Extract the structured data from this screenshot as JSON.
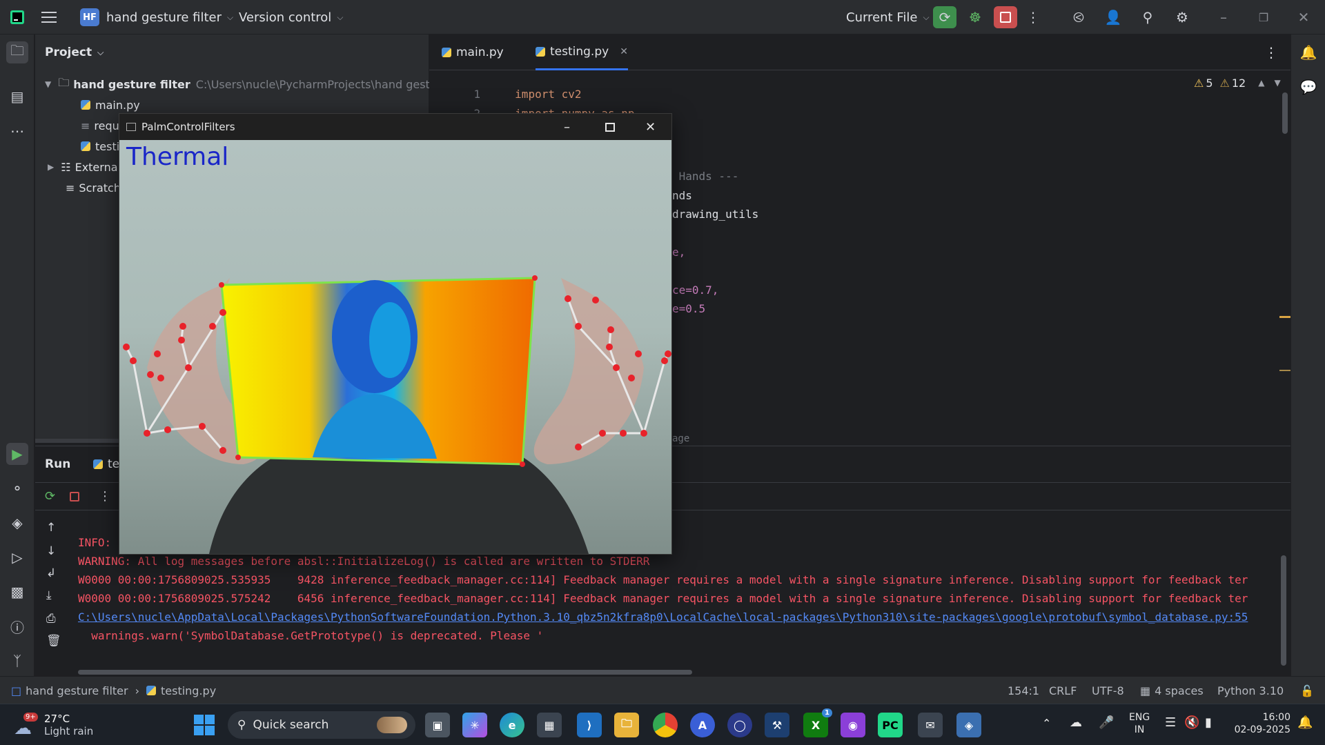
{
  "titlebar": {
    "project_badge": "HF",
    "project_name": "hand gesture filter",
    "vcs_label": "Version control",
    "run_config": "Current File"
  },
  "project_panel": {
    "title": "Project",
    "root_name": "hand gesture filter",
    "root_path": "C:\\Users\\nucle\\PycharmProjects\\hand gestu",
    "items": [
      "main.py",
      "requ",
      "testi",
      "Externa",
      "Scratch"
    ]
  },
  "editor": {
    "tabs": [
      "main.py",
      "testing.py"
    ],
    "inspections": {
      "warnings": "5",
      "weak_warnings": "12"
    },
    "lines": [
      {
        "n": "1",
        "code": "import cv2"
      },
      {
        "n": "2",
        "code": "import numpy as np"
      }
    ],
    "partial_lines": [
      " Hands ---",
      "nds",
      "drawing_utils",
      "e,",
      "ce=0.7,",
      "e=0.5",
      "age"
    ]
  },
  "float_window": {
    "title": "PalmControlFilters",
    "overlay_text": "Thermal"
  },
  "run_panel": {
    "title": "Run",
    "tab_label": "te",
    "logs": [
      {
        "text": "INFO:",
        "type": "err"
      },
      {
        "text": "WARNING: All log messages before absl::InitializeLog() is called are written to STDERR",
        "type": "err"
      },
      {
        "text": "W0000 00:00:1756809025.535935    9428 inference_feedback_manager.cc:114] Feedback manager requires a model with a single signature inference. Disabling support for feedback ter",
        "type": "err"
      },
      {
        "text": "W0000 00:00:1756809025.575242    6456 inference_feedback_manager.cc:114] Feedback manager requires a model with a single signature inference. Disabling support for feedback ter",
        "type": "err"
      },
      {
        "text": "C:\\Users\\nucle\\AppData\\Local\\Packages\\PythonSoftwareFoundation.Python.3.10_qbz5n2kfra8p0\\LocalCache\\local-packages\\Python310\\site-packages\\google\\protobuf\\symbol_database.py:55",
        "type": "link"
      },
      {
        "text": "  warnings.warn('SymbolDatabase.GetPrototype() is deprecated. Please '",
        "type": "err"
      }
    ]
  },
  "statusbar": {
    "breadcrumb_project": "hand gesture filter",
    "breadcrumb_file": "testing.py",
    "position": "154:1",
    "line_sep": "CRLF",
    "encoding": "UTF-8",
    "indent": "4 spaces",
    "interpreter": "Python 3.10"
  },
  "taskbar": {
    "weather_temp": "27°C",
    "weather_desc": "Light rain",
    "weather_badge": "9+",
    "search_placeholder": "Quick search",
    "lang_top": "ENG",
    "lang_bottom": "IN",
    "time": "16:00",
    "date": "02-09-2025",
    "xbox_badge": "1"
  },
  "colors": {
    "ide_bg": "#1e1f22",
    "panel_bg": "#2b2d30",
    "run_green": "#3e8f4d",
    "stop_red": "#c94f4f",
    "error_text": "#f75464",
    "link_text": "#548af7",
    "overlay_text": "#1a26c8"
  }
}
